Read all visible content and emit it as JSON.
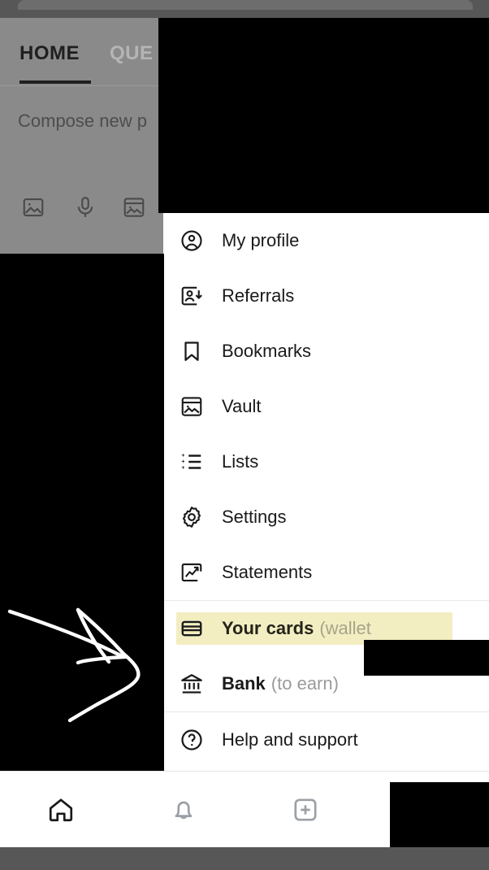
{
  "app": {
    "tabs": [
      {
        "id": "home",
        "label": "HOME",
        "active": true
      },
      {
        "id": "questions",
        "label": "QUE",
        "active": false
      }
    ],
    "compose": {
      "placeholder": "Compose new p",
      "icons": [
        {
          "name": "image-icon",
          "label": "Add image"
        },
        {
          "name": "microphone-icon",
          "label": "Voice input"
        },
        {
          "name": "vault-image-icon",
          "label": "Vault"
        }
      ]
    }
  },
  "menu": {
    "items": [
      {
        "id": "my-profile",
        "icon": "user-circle-icon",
        "label": "My profile",
        "sub": "",
        "bold": false,
        "highlighted": false
      },
      {
        "id": "referrals",
        "icon": "user-add-icon",
        "label": "Referrals",
        "sub": "",
        "bold": false,
        "highlighted": false
      },
      {
        "id": "bookmarks",
        "icon": "bookmark-icon",
        "label": "Bookmarks",
        "sub": "",
        "bold": false,
        "highlighted": false
      },
      {
        "id": "vault",
        "icon": "vault-image-icon",
        "label": "Vault",
        "sub": "",
        "bold": false,
        "highlighted": false
      },
      {
        "id": "lists",
        "icon": "star-list-icon",
        "label": "Lists",
        "sub": "",
        "bold": false,
        "highlighted": false
      },
      {
        "id": "settings",
        "icon": "gear-icon",
        "label": "Settings",
        "sub": "",
        "bold": false,
        "highlighted": false
      },
      {
        "id": "statements",
        "icon": "chart-arrow-icon",
        "label": "Statements",
        "sub": "",
        "bold": false,
        "highlighted": false
      },
      {
        "id": "your-cards",
        "icon": "credit-card-icon",
        "label": "Your cards",
        "sub": "(wallet",
        "bold": true,
        "highlighted": true
      },
      {
        "id": "bank",
        "icon": "bank-icon",
        "label": "Bank",
        "sub": "(to earn)",
        "bold": true,
        "highlighted": false
      },
      {
        "id": "help-and-support",
        "icon": "question-circle-icon",
        "label": "Help and support",
        "sub": "",
        "bold": false,
        "highlighted": false
      }
    ]
  },
  "bottom_nav": {
    "items": [
      {
        "id": "home",
        "icon": "home-icon",
        "active": true
      },
      {
        "id": "notifications",
        "icon": "bell-icon",
        "active": false
      },
      {
        "id": "create",
        "icon": "plus-square-icon",
        "active": false
      },
      {
        "id": "messages",
        "icon": "chat-bubble-icon",
        "active": false
      }
    ]
  },
  "annotation": {
    "type": "hand-drawn-arrow",
    "direction": "right",
    "color": "#ffffff"
  },
  "colors": {
    "highlight_yellow": "#f2eec2",
    "scrim_gray": "#8a8a8a",
    "chrome_gray": "#575757",
    "text_primary": "#1a1a1a",
    "text_muted": "#9b9b9b",
    "nav_idle": "#9aa0a6",
    "redaction_black": "#000000"
  }
}
